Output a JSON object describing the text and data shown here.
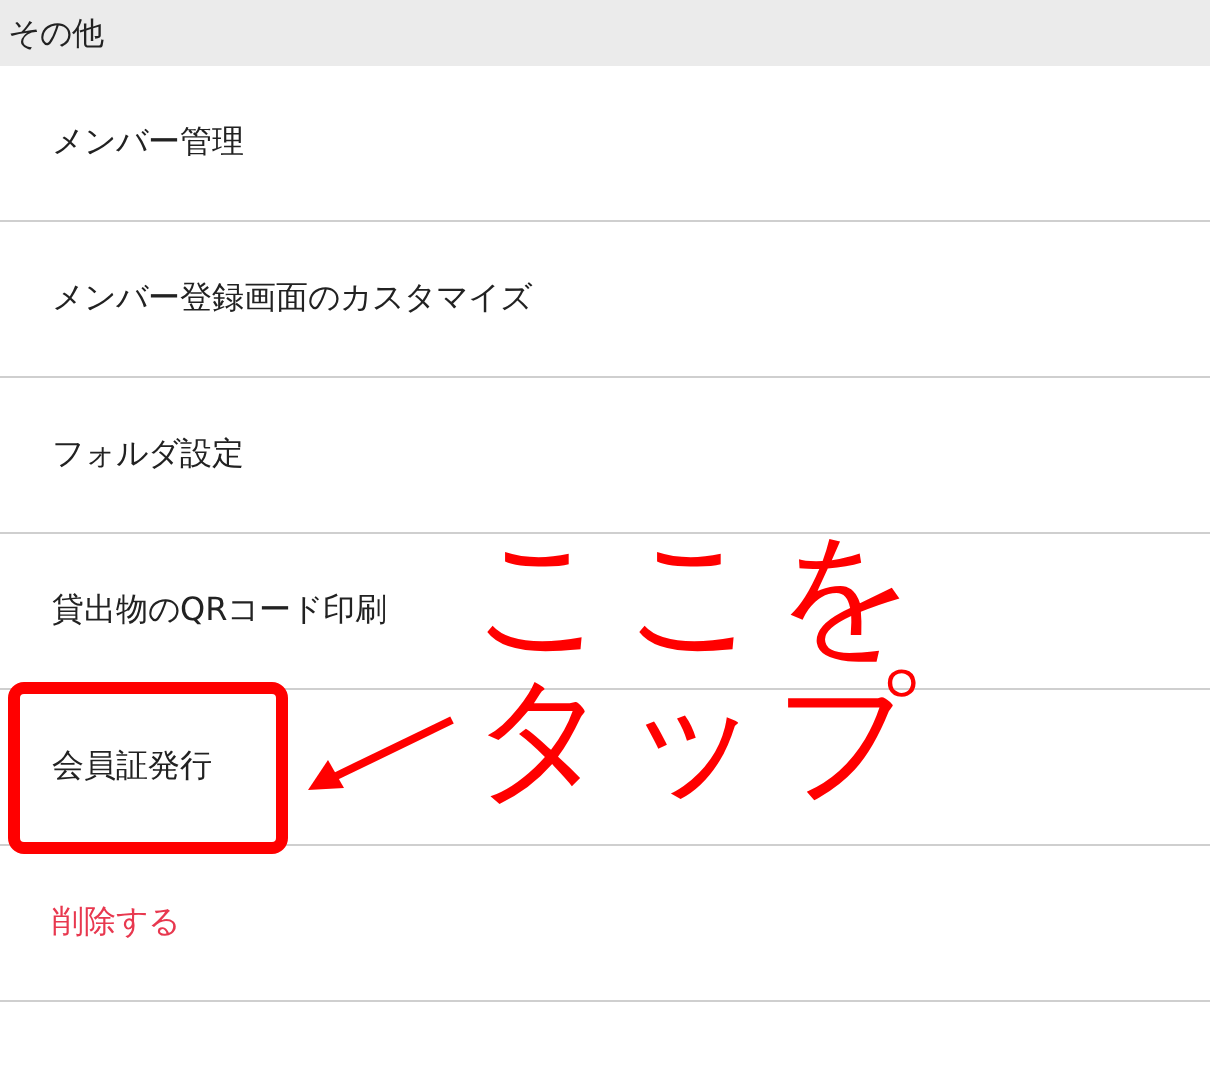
{
  "section_header": {
    "title": "その他"
  },
  "items": [
    {
      "label": "メンバー管理",
      "kind": "normal",
      "highlighted": false
    },
    {
      "label": "メンバー登録画面のカスタマイズ",
      "kind": "normal",
      "highlighted": false
    },
    {
      "label": "フォルダ設定",
      "kind": "normal",
      "highlighted": false
    },
    {
      "label": "貸出物のQRコード印刷",
      "kind": "normal",
      "highlighted": false
    },
    {
      "label": "会員証発行",
      "kind": "normal",
      "highlighted": true
    },
    {
      "label": "削除する",
      "kind": "danger",
      "highlighted": false
    }
  ],
  "annotation": {
    "lines": [
      "ここを",
      "タップ"
    ]
  }
}
